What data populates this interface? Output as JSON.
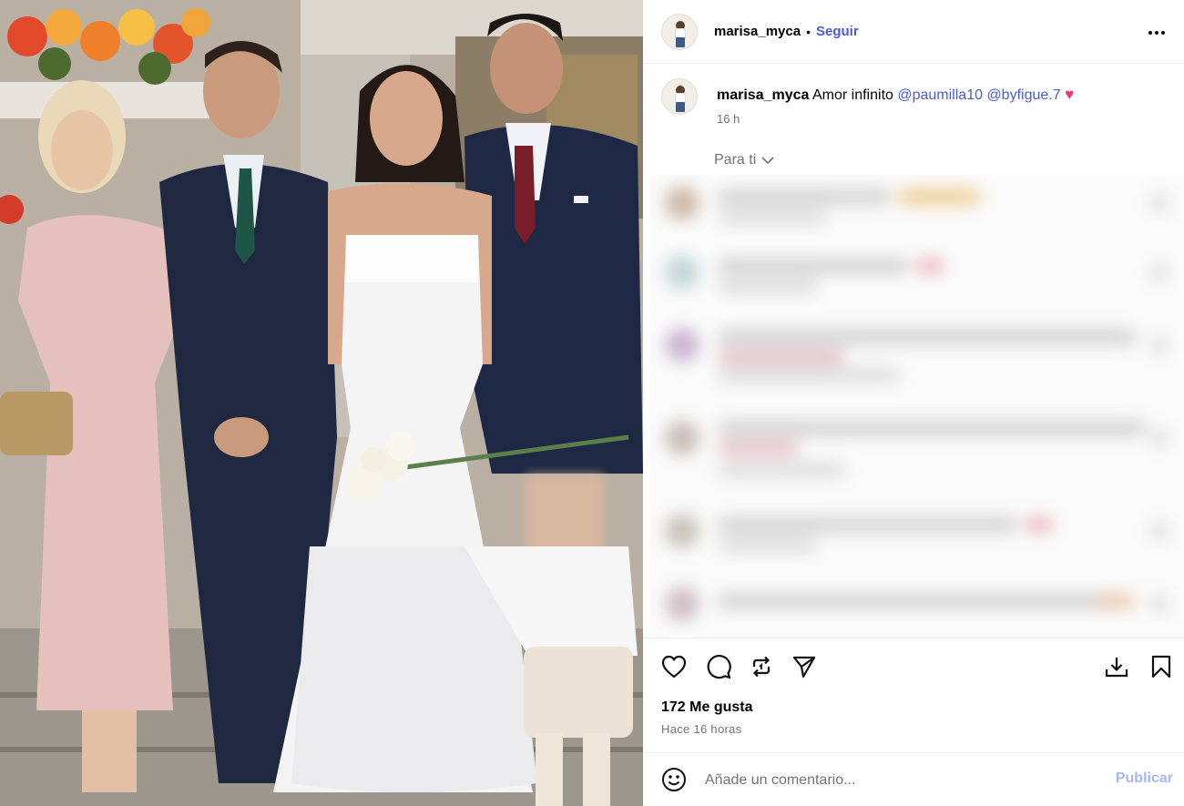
{
  "post": {
    "username": "marisa_myca",
    "separator": "•",
    "follow_label": "Seguir",
    "more_icon": "more-horizontal-icon"
  },
  "caption": {
    "username": "marisa_myca",
    "text": "Amor infinito",
    "mention_1": "@paumilla10",
    "mention_2": "@byfigue.7",
    "emoji": "♥",
    "time": "16 h"
  },
  "comments_filter": {
    "label": "Para ti"
  },
  "actions": {
    "icons": [
      "heart-icon",
      "comment-icon",
      "repost-icon",
      "share-icon",
      "save-download-icon",
      "bookmark-icon"
    ]
  },
  "stats": {
    "likes": "172 Me gusta",
    "posted": "Hace 16 horas"
  },
  "comment_box": {
    "placeholder": "Añade un comentario...",
    "publish_label": "Publicar"
  },
  "colors": {
    "link": "#4a5bd6",
    "publish_disabled": "#a7b8f1",
    "secondary_text": "#737373",
    "heart_emoji": "#f0367a"
  }
}
